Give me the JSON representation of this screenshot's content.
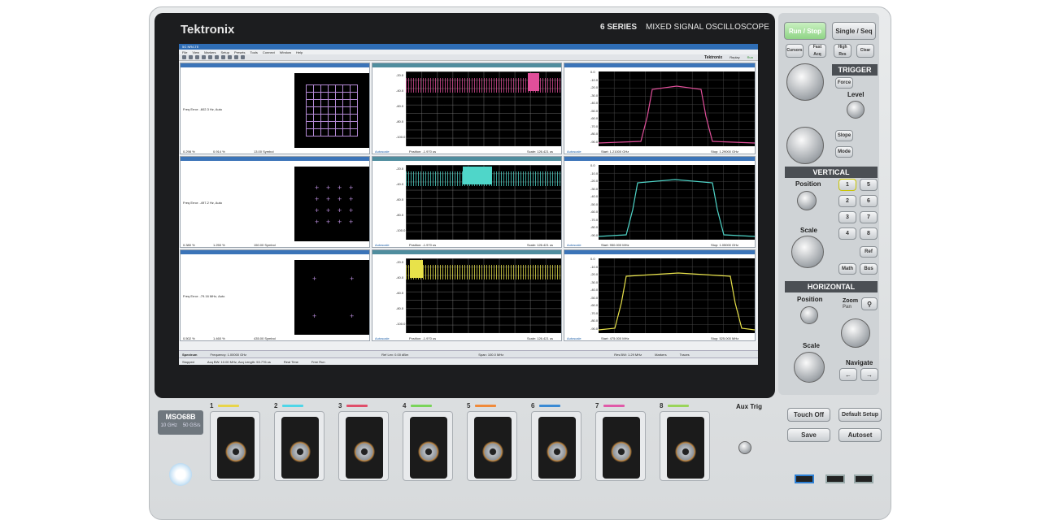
{
  "device": {
    "brand": "Tektronix",
    "series": "6 SERIES",
    "subtitle": "MIXED SIGNAL OSCILLOSCOPE",
    "model": "MSO68B",
    "spec_bw": "10 GHz",
    "spec_rate": "50 GS/s"
  },
  "screen": {
    "app_title": "5G NR/LTE",
    "menu": [
      "File",
      "View",
      "Markers",
      "Setup",
      "Presets",
      "Tools",
      "Connect",
      "Window",
      "Help"
    ],
    "toolbar_brand": "Tektronix",
    "replay": "Replay",
    "run": "Run",
    "rows": [
      {
        "freq_error": "Freq Error: -602.3 Hz, Auto",
        "evm": "0.298 %",
        "peak": "0.914 %",
        "time_to_sym": "13.00 Symbol",
        "color": "#e04f9a"
      },
      {
        "freq_error": "Freq Error: -497.2 Hz, Auto",
        "evm": "0.380 %",
        "peak": "1.250 %",
        "time_to_sym": "150.00 Symbol",
        "color": "#4fd6c9"
      },
      {
        "freq_error": "Freq Error: -79.16 MHz, Auto",
        "evm": "0.502 %",
        "peak": "1.460 %",
        "time_to_sym": "435.00 Symbol",
        "color": "#e8e24a"
      }
    ],
    "time_y_ticks": [
      "-20.0",
      "-40.0",
      "-60.0",
      "-80.0",
      "-100.0"
    ],
    "spec_y_ticks": [
      "0.0",
      "-10.0",
      "-20.0",
      "-30.0",
      "-40.0",
      "-50.0",
      "-60.0",
      "-70.0",
      "-80.0",
      "-90.0"
    ],
    "time_footer_pos": "Position: -1.970 us",
    "time_footer_scale": "Scale: 126.421 us",
    "spec_start": [
      "Start: 1.21000 GHz",
      "Start: 950.000 MHz",
      "Start: 475.000 MHz"
    ],
    "spec_stop": [
      "Stop: 1.29000 GHz",
      "Stop: 1.05000 GHz",
      "Stop: 525.000 MHz"
    ],
    "autoscale": "Autoscale",
    "spectrum_label": "Spectrum",
    "frequency": "Frequency: 1.00000 GHz",
    "ref_lev": "Ref Lev: 0.00 dBm",
    "span": "Span: 100.0 MHz",
    "res_bw": "Res BW: 1.29 MHz",
    "markers": "Markers",
    "traces": "Traces",
    "status_stopped": "Stopped",
    "status_acq": "Acq BW: 10.00 MHz, Acq Length: 53.776 us",
    "status_real_time": "Real Time",
    "status_free_run": "Free Run"
  },
  "front_panel": {
    "run_stop": "Run / Stop",
    "single_seq": "Single / Seq",
    "cursors": "Cursors",
    "fast_acq": "Fast Acq",
    "high_res": "High Res",
    "clear": "Clear",
    "trigger_head": "TRIGGER",
    "force": "Force",
    "level": "Level",
    "slope": "Slope",
    "mode": "Mode",
    "vertical_head": "VERTICAL",
    "position": "Position",
    "scale": "Scale",
    "channels": [
      "1",
      "2",
      "3",
      "4",
      "5",
      "6",
      "7",
      "8"
    ],
    "ref": "Ref",
    "math": "Math",
    "bus": "Bus",
    "horizontal_head": "HORIZONTAL",
    "zoom": "Zoom",
    "pan": "Pan",
    "navigate": "Navigate",
    "touch_off": "Touch Off",
    "default_setup": "Default Setup",
    "save": "Save",
    "autoset": "Autoset",
    "aux_trig": "Aux Trig"
  },
  "channel_colors": [
    "#e8d44a",
    "#4fd6e8",
    "#e04f6a",
    "#7ad45a",
    "#f08a3a",
    "#3a8ad4",
    "#e05aa8",
    "#9ad45a"
  ]
}
